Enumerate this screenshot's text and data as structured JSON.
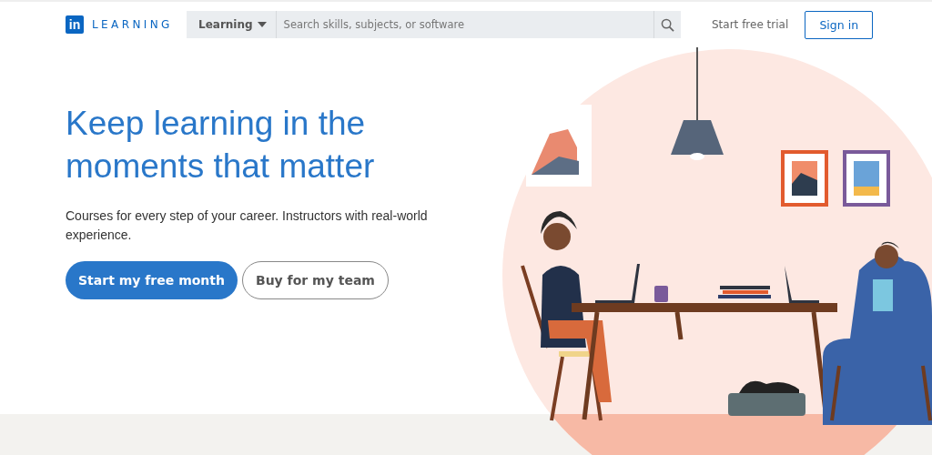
{
  "header": {
    "logo_mark": "in",
    "logo_text": "LEARNING",
    "search": {
      "scope": "Learning",
      "placeholder": "Search skills, subjects, or software"
    },
    "links": [
      "Start free trial"
    ],
    "sign_in": "Sign in"
  },
  "hero": {
    "headline": "Keep learning in the moments that matter",
    "subtitle": "Courses for every step of your career. Instructors with real-world experience.",
    "buttons": [
      {
        "label": "Start my free month",
        "kind": "primary"
      },
      {
        "label": "Buy for my team",
        "kind": "secondary"
      }
    ]
  }
}
